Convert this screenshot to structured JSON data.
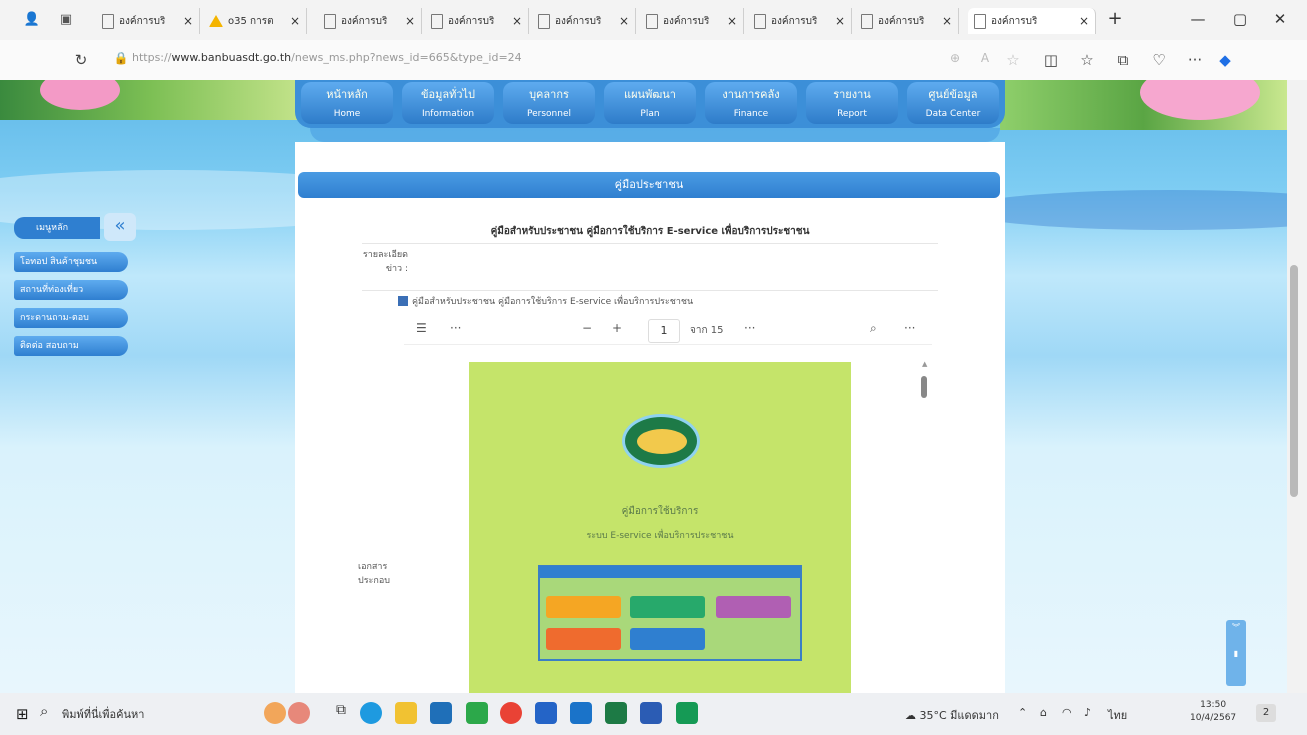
{
  "browser": {
    "tabs": [
      {
        "title": "องค์การบริ",
        "icon": "page-icon"
      },
      {
        "title": "o35 การต",
        "icon": "drive-icon"
      },
      {
        "title": "องค์การบริ",
        "icon": "page-icon"
      },
      {
        "title": "องค์การบริ",
        "icon": "page-icon"
      },
      {
        "title": "องค์การบริ",
        "icon": "page-icon"
      },
      {
        "title": "องค์การบริ",
        "icon": "page-icon"
      },
      {
        "title": "องค์การบริ",
        "icon": "page-icon"
      },
      {
        "title": "องค์การบริ",
        "icon": "page-icon"
      },
      {
        "title": "องค์การบริ",
        "icon": "page-icon"
      }
    ],
    "new_tab": "+",
    "close_tab": "×",
    "url_prefix": "https://",
    "url_host": "www.banbuasdt.go.th",
    "url_path": "/news_ms.php?news_id=665&type_id=24",
    "win_min": "—",
    "win_restore": "▢",
    "win_close": "✕"
  },
  "nav": [
    {
      "th": "หน้าหลัก",
      "en": "Home"
    },
    {
      "th": "ข้อมูลทั่วไป",
      "en": "Information"
    },
    {
      "th": "บุคลากร",
      "en": "Personnel"
    },
    {
      "th": "แผนพัฒนา",
      "en": "Plan"
    },
    {
      "th": "งานการคลัง",
      "en": "Finance"
    },
    {
      "th": "รายงาน",
      "en": "Report"
    },
    {
      "th": "ศูนย์ข้อมูล",
      "en": "Data Center"
    }
  ],
  "section_title": "คู่มือประชาชน",
  "article": {
    "title": "คู่มือสำหรับประชาชน คู่มือการใช้บริการ E-service เพื่อบริการประชาชน",
    "detail_label": "รายละเอียดข่าว :",
    "attach_label": "เอกสารประกอบ",
    "attach_name": "คู่มือสำหรับประชาชน คู่มือการใช้บริการ E-service เพื่อบริการประชาชน"
  },
  "pdf": {
    "page": "1",
    "total": "จาก 15",
    "more": "···",
    "zoom_out": "−",
    "zoom_in": "+",
    "page_heading": "คู่มือการใช้บริการ",
    "page_subheading": "ระบบ E-service เพื่อบริการประชาชน"
  },
  "menu": {
    "head": "เมนูหลัก",
    "collapse": "«",
    "items": [
      "โอทอป สินค้าชุมชน",
      "สถานที่ท่องเที่ยว",
      "กระดานถาม-ตอบ",
      "ติดต่อ สอบถาม"
    ]
  },
  "taskbar": {
    "search_placeholder": "พิมพ์ที่นี่เพื่อค้นหา",
    "weather": "35°C มีแดดมาก",
    "lang": "ไทย",
    "time": "13:50",
    "date": "10/4/2567",
    "notifications": "2"
  }
}
